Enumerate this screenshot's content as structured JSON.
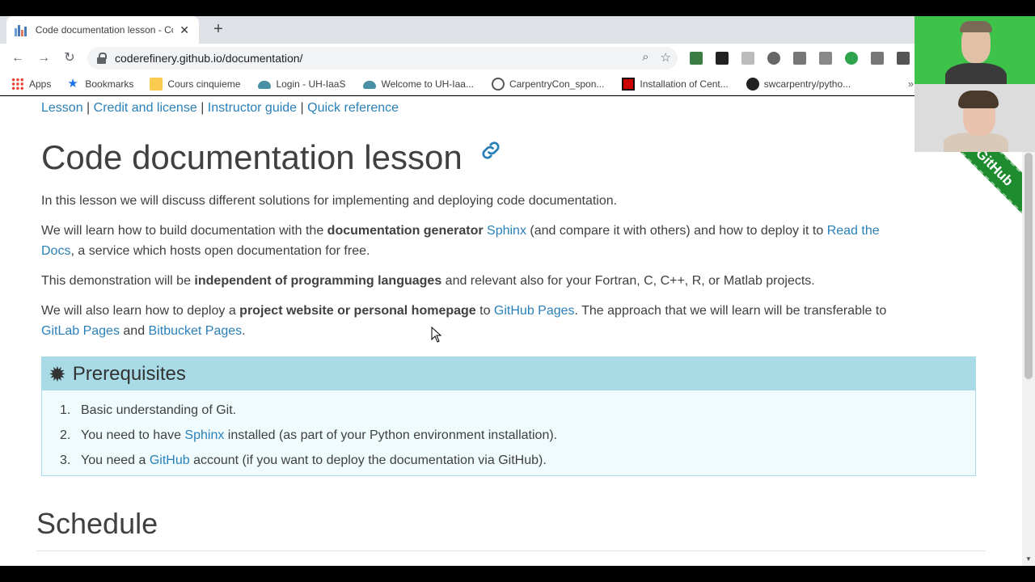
{
  "browser": {
    "tab_title": "Code documentation lesson - Co",
    "close_glyph": "✕",
    "newtab_glyph": "+",
    "url": "coderefinery.github.io/documentation/",
    "bookmarks": [
      {
        "label": "Apps",
        "icon": "apps-grid-icon"
      },
      {
        "label": "Bookmarks",
        "icon": "star-icon"
      },
      {
        "label": "Cours cinquieme",
        "icon": "folder-icon"
      },
      {
        "label": "Login - UH-IaaS",
        "icon": "cloud-icon"
      },
      {
        "label": "Welcome to UH-Iaa...",
        "icon": "cloud-icon"
      },
      {
        "label": "CarpentryCon_spon...",
        "icon": "globe-icon"
      },
      {
        "label": "Installation of Cent...",
        "icon": "red-square-icon"
      },
      {
        "label": "swcarpentry/pytho...",
        "icon": "github-icon"
      }
    ],
    "bookmarks_more": "»"
  },
  "page": {
    "crumbs": [
      "Lesson",
      "Credit and license",
      "Instructor guide",
      "Quick reference"
    ],
    "crumb_sep": "|",
    "title": "Code documentation lesson",
    "intro": "In this lesson we will discuss different solutions for implementing and deploying code documentation.",
    "p2": {
      "a": "We will learn how to build documentation with the ",
      "b": "documentation generator",
      "c": " ",
      "link1": "Sphinx",
      "d": " (and compare it with others) and how to deploy it to ",
      "link2a": "Read the",
      "link2b": "Docs",
      "e": ", a service which hosts open documentation for free."
    },
    "p3": {
      "a": "This demonstration will be ",
      "b": "independent of programming languages",
      "c": " and relevant also for your Fortran, C, C++, R, or Matlab projects."
    },
    "p4": {
      "a": "We will also learn how to deploy a ",
      "b": "project website or personal homepage",
      "c": " to ",
      "link1": "GitHub Pages",
      "d": ". The approach that we will learn will be transferable to",
      "link2": "GitLab Pages",
      "e": " and ",
      "link3": "Bitbucket Pages",
      "f": "."
    },
    "prereq": {
      "title": "Prerequisites",
      "items": [
        {
          "num": "1.",
          "a": "Basic understanding of Git.",
          "link": "",
          "b": ""
        },
        {
          "num": "2.",
          "a": "You need to have ",
          "link": "Sphinx",
          "b": " installed (as part of your Python environment installation)."
        },
        {
          "num": "3.",
          "a": "You need a ",
          "link": "GitHub",
          "b": " account (if you want to deploy the documentation via GitHub)."
        }
      ]
    },
    "schedule_title": "Schedule",
    "ribbon_text": "on GitHub"
  }
}
